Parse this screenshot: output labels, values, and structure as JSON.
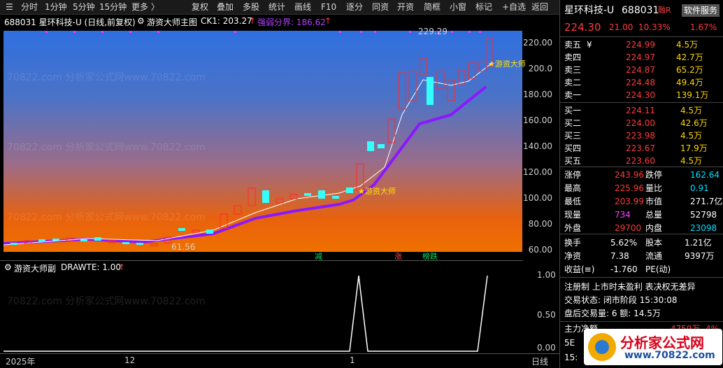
{
  "toolbar": {
    "items": [
      "分时",
      "1分钟",
      "5分钟",
      "15分钟",
      "更多 〉",
      "复权",
      "叠加",
      "多股",
      "统计",
      "画线",
      "F10",
      "逐分",
      "同资",
      "开资",
      "简框",
      "小窗",
      "标记",
      "+自选",
      "返回"
    ]
  },
  "chart_header": {
    "title": "688031 星环科技-U (日线,前复权)",
    "indicator": "游资大师主图",
    "ck1": "CK1: 203.27",
    "ck1_arrow": "↑",
    "boundary": "强弱分界: 186.62",
    "boundary_arrow": "↑"
  },
  "main_chart": {
    "y_ticks": [
      "220.00",
      "200.0",
      "180.00",
      "160.00",
      "140.00",
      "120.00",
      "100.00",
      "80.00",
      "60.00"
    ],
    "high_label": "229.29",
    "low_label": "61.56",
    "star_label_1": "★游资大师",
    "star_label_2": "★游资大师",
    "signal_1": "减",
    "signal_2": "涨",
    "signal_3": "榜跌"
  },
  "sub_chart": {
    "header": "游资大师副",
    "drawte": "DRAWTE: 1.00",
    "drawte_arrow": "↑",
    "y_ticks": [
      "1.00",
      "0.50",
      "0.00"
    ]
  },
  "x_axis": {
    "labels": [
      "2025年",
      "12",
      "1"
    ],
    "period": "日线"
  },
  "panel": {
    "name": "星环科技-U",
    "code": "688031",
    "badge": "融R",
    "service": "软件服务",
    "price": "224.30",
    "change": "21.00",
    "change_pct": "10.33%",
    "turnover_small": "1.67%",
    "asks": [
      {
        "label": "卖五",
        "flag": "¥",
        "price": "224.99",
        "vol": "4.5万"
      },
      {
        "label": "卖四",
        "flag": "",
        "price": "224.97",
        "vol": "42.7万"
      },
      {
        "label": "卖三",
        "flag": "",
        "price": "224.87",
        "vol": "65.2万"
      },
      {
        "label": "卖二",
        "flag": "",
        "price": "224.48",
        "vol": "49.4万"
      },
      {
        "label": "卖一",
        "flag": "",
        "price": "224.30",
        "vol": "139.1万"
      }
    ],
    "bids": [
      {
        "label": "买一",
        "price": "224.11",
        "vol": "4.5万"
      },
      {
        "label": "买二",
        "price": "224.00",
        "vol": "42.6万"
      },
      {
        "label": "买三",
        "price": "223.98",
        "vol": "4.5万"
      },
      {
        "label": "买四",
        "price": "223.67",
        "vol": "17.9万"
      },
      {
        "label": "买五",
        "price": "223.60",
        "vol": "4.5万"
      }
    ],
    "stats": [
      {
        "k1": "涨停",
        "v1": "243.96",
        "c1": "red",
        "k2": "跌停",
        "v2": "162.64",
        "c2": "cyan"
      },
      {
        "k1": "最高",
        "v1": "225.96",
        "c1": "red",
        "k2": "量比",
        "v2": "0.91",
        "c2": "cyan"
      },
      {
        "k1": "最低",
        "v1": "203.99",
        "c1": "red",
        "k2": "市值",
        "v2": "271.7亿",
        "c2": "white"
      },
      {
        "k1": "现量",
        "v1": "734",
        "c1": "magenta",
        "k2": "总量",
        "v2": "52798",
        "c2": "white"
      },
      {
        "k1": "外盘",
        "v1": "29700",
        "c1": "red",
        "k2": "内盘",
        "v2": "23098",
        "c2": "cyan"
      }
    ],
    "stats2": [
      {
        "k1": "换手",
        "v1": "5.62%",
        "k2": "股本",
        "v2": "1.21亿"
      },
      {
        "k1": "净资",
        "v1": "7.38",
        "k2": "流通",
        "v2": "9397万"
      },
      {
        "k1": "收益(≡)",
        "v1": "-1.760",
        "k2": "PE(动)",
        "v2": ""
      }
    ],
    "notice": "注册制 上市时未盈利 表决权无差异",
    "trade_status": "交易状态: 闭市阶段 15:30:08",
    "after_hours": "盘后交易量: 6  额: 14.5万",
    "main_flow_label": "主力净额",
    "main_flow_value": "4759万",
    "main_flow_pct": "4%",
    "row_5e": "5E",
    "row_15": "15:",
    "logo_text": "分析家公式网",
    "logo_url": "www.70822.com"
  },
  "watermark": "70822.com 分析家公式网www.70822.com"
}
